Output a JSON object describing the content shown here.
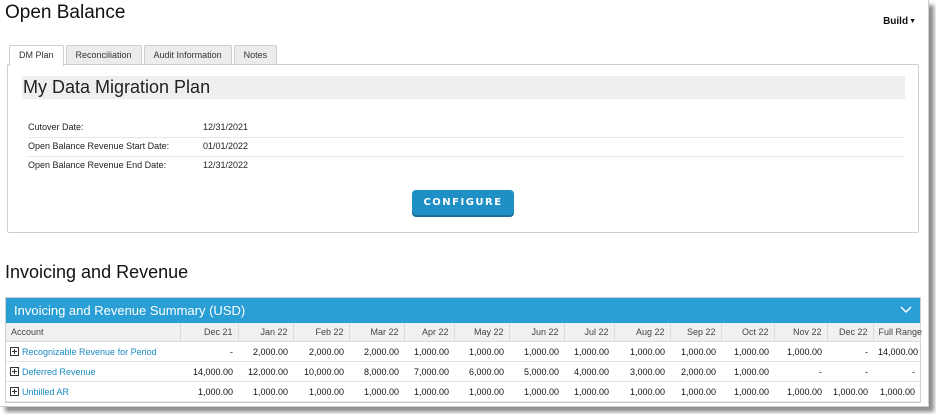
{
  "page": {
    "title": "Open Balance",
    "build_menu": "Build"
  },
  "tabs": [
    {
      "label": "DM Plan",
      "active": true
    },
    {
      "label": "Reconciliation"
    },
    {
      "label": "Audit Information"
    },
    {
      "label": "Notes"
    }
  ],
  "plan": {
    "title": "My Data Migration Plan",
    "fields": [
      {
        "label": "Cutover Date:",
        "value": "12/31/2021"
      },
      {
        "label": "Open Balance Revenue Start Date:",
        "value": "01/01/2022"
      },
      {
        "label": "Open Balance Revenue End Date:",
        "value": "12/31/2022"
      }
    ],
    "configure_label": "CONFIGURE"
  },
  "invoicing": {
    "section_title": "Invoicing and Revenue",
    "summary_title": "Invoicing and Revenue Summary (USD)",
    "columns": [
      "Account",
      "Dec 21",
      "Jan 22",
      "Feb 22",
      "Mar 22",
      "Apr 22",
      "May 22",
      "Jun 22",
      "Jul 22",
      "Aug 22",
      "Sep 22",
      "Oct 22",
      "Nov 22",
      "Dec 22",
      "Full Range"
    ],
    "rows": [
      {
        "account": "Recognizable Revenue for Period",
        "values": [
          "-",
          "2,000.00",
          "2,000.00",
          "2,000.00",
          "1,000.00",
          "1,000.00",
          "1,000.00",
          "1,000.00",
          "1,000.00",
          "1,000.00",
          "1,000.00",
          "1,000.00",
          "-",
          "14,000.00"
        ]
      },
      {
        "account": "Deferred Revenue",
        "values": [
          "14,000.00",
          "12,000.00",
          "10,000.00",
          "8,000.00",
          "7,000.00",
          "6,000.00",
          "5,000.00",
          "4,000.00",
          "3,000.00",
          "2,000.00",
          "1,000.00",
          "-",
          "-",
          "-"
        ]
      },
      {
        "account": "Unbilled AR",
        "values": [
          "1,000.00",
          "1,000.00",
          "1,000.00",
          "1,000.00",
          "1,000.00",
          "1,000.00",
          "1,000.00",
          "1,000.00",
          "1,000.00",
          "1,000.00",
          "1,000.00",
          "1,000.00",
          "1,000.00",
          "1,000.00"
        ]
      }
    ]
  },
  "colors": {
    "accent": "#2a9fd6",
    "button": "#1e90c6",
    "link": "#1a8ac2"
  }
}
